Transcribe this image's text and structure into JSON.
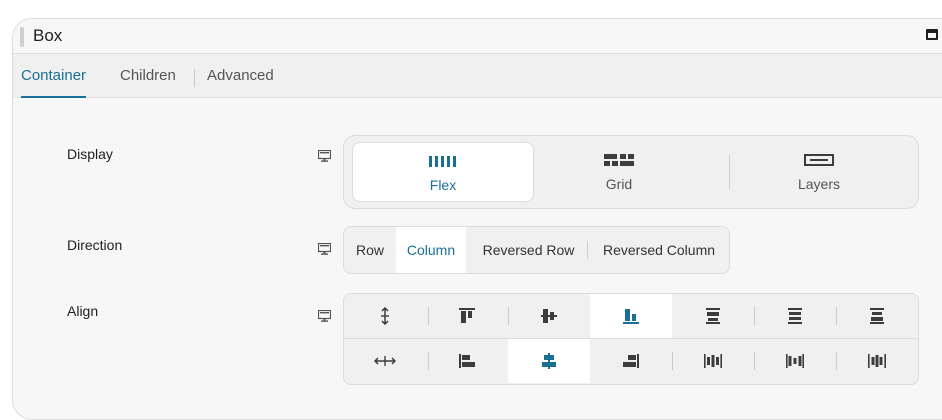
{
  "panel": {
    "title": "Box"
  },
  "tabs": [
    {
      "label": "Container",
      "active": true
    },
    {
      "label": "Children",
      "active": false
    },
    {
      "label": "Advanced",
      "active": false
    }
  ],
  "display": {
    "label": "Display",
    "device_icon": "desktop-icon",
    "options": [
      {
        "label": "Flex",
        "icon": "flex-icon",
        "active": true
      },
      {
        "label": "Grid",
        "icon": "grid-icon",
        "active": false
      },
      {
        "label": "Layers",
        "icon": "layers-icon",
        "active": false
      }
    ]
  },
  "direction": {
    "label": "Direction",
    "device_icon": "desktop-icon",
    "options": [
      {
        "label": "Row",
        "active": false
      },
      {
        "label": "Column",
        "active": true
      },
      {
        "label": "Reversed Row",
        "active": false
      },
      {
        "label": "Reversed Column",
        "active": false
      }
    ]
  },
  "align": {
    "label": "Align",
    "device_icon": "desktop-icon",
    "row1": [
      {
        "icon": "align-stretch-vertical-icon",
        "active": false
      },
      {
        "icon": "align-top-icon",
        "active": false
      },
      {
        "icon": "align-middle-icon",
        "active": false
      },
      {
        "icon": "align-bottom-icon",
        "active": true
      },
      {
        "icon": "justify-start-vertical-icon",
        "active": false
      },
      {
        "icon": "justify-center-vertical-icon",
        "active": false
      },
      {
        "icon": "justify-end-vertical-icon",
        "active": false
      }
    ],
    "row2": [
      {
        "icon": "align-stretch-horizontal-icon",
        "active": false
      },
      {
        "icon": "align-left-icon",
        "active": false
      },
      {
        "icon": "align-center-icon",
        "active": true
      },
      {
        "icon": "align-right-icon",
        "active": false
      },
      {
        "icon": "space-between-icon",
        "active": false
      },
      {
        "icon": "space-around-icon",
        "active": false
      },
      {
        "icon": "space-evenly-icon",
        "active": false
      }
    ]
  },
  "colors": {
    "accent": "#1a6f94",
    "text": "#1e1e1e",
    "background": "#f7f7f7"
  }
}
